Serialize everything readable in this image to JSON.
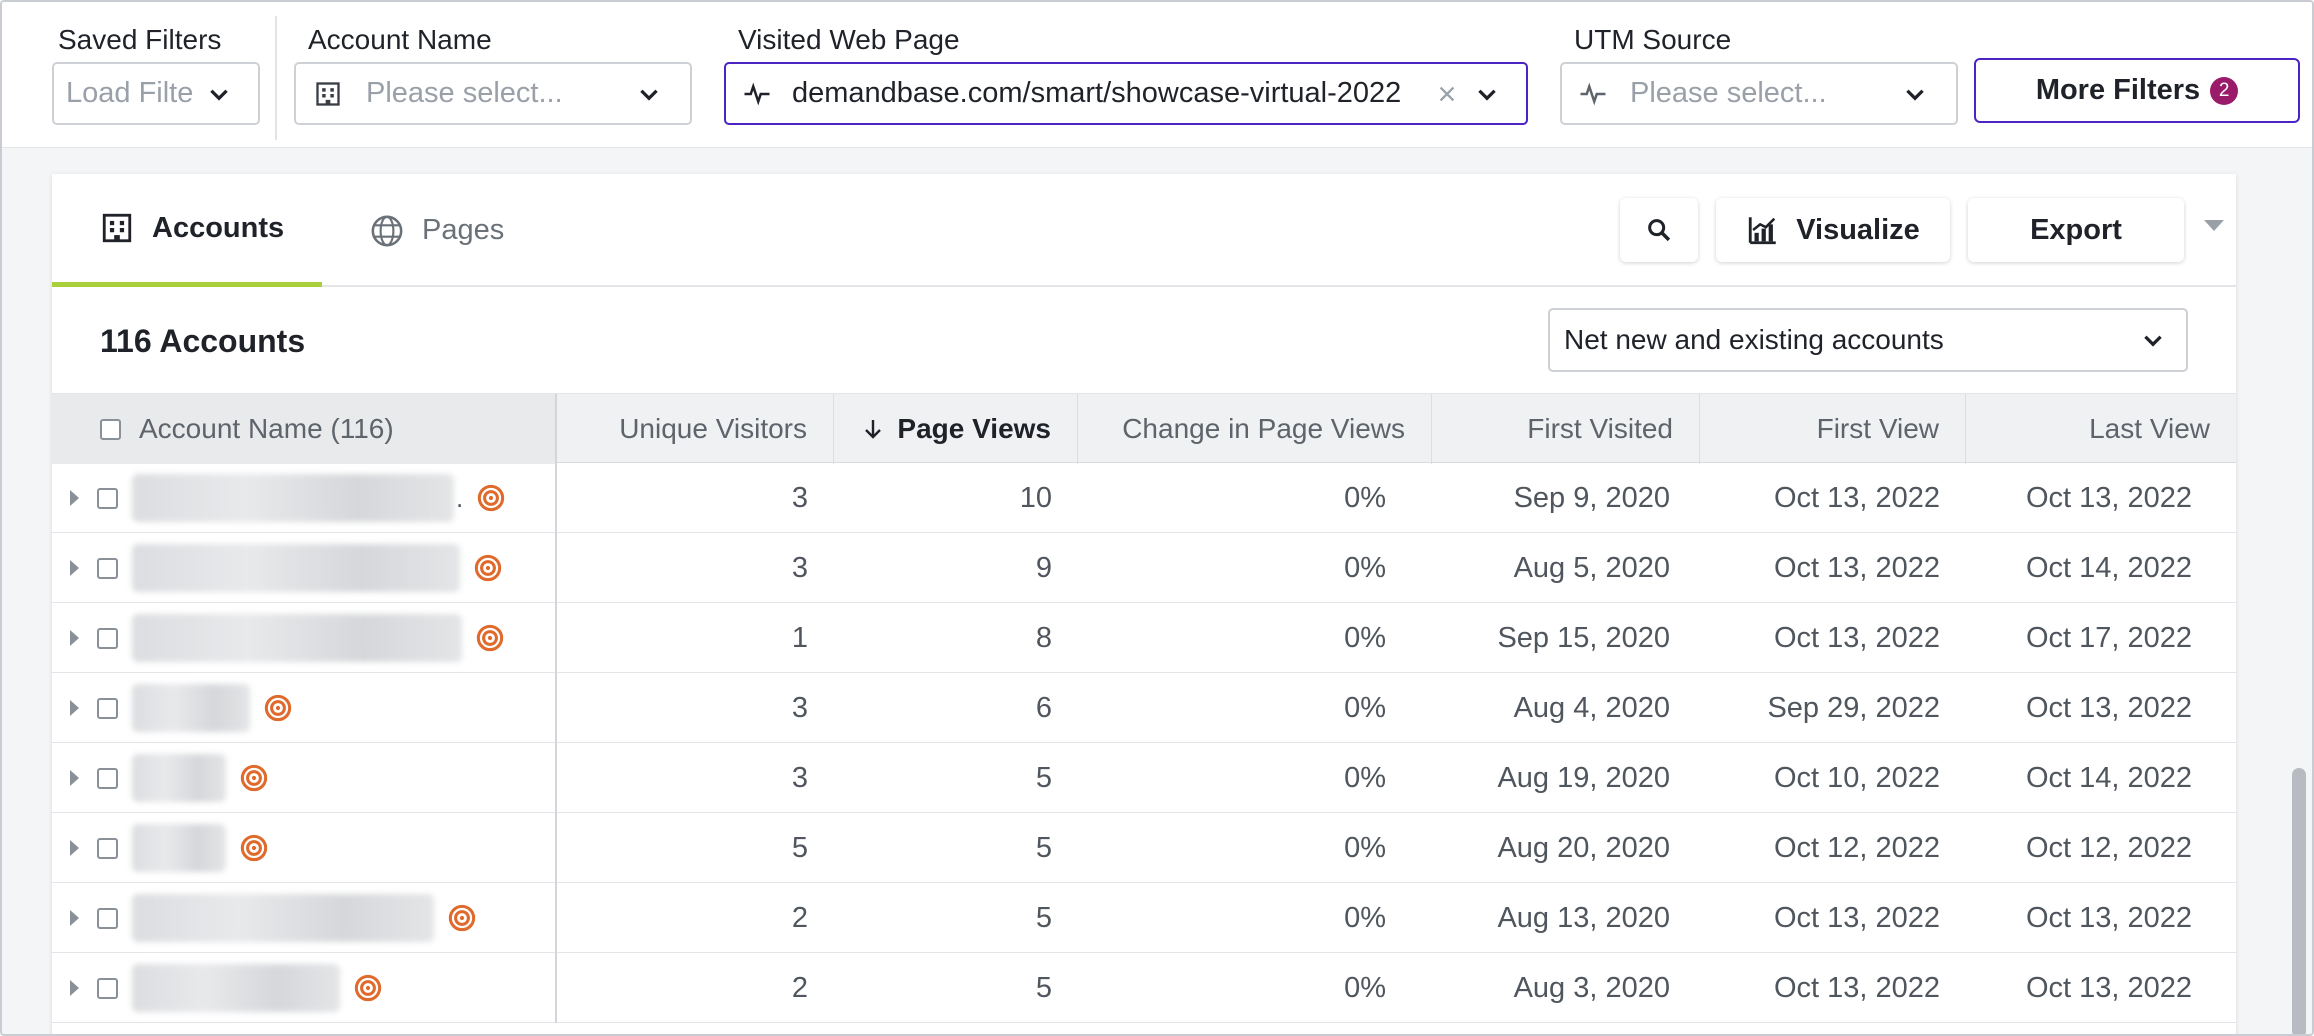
{
  "filters": {
    "saved": {
      "label": "Saved Filters",
      "placeholder": "Load Filte"
    },
    "account_name": {
      "label": "Account Name",
      "placeholder": "Please select..."
    },
    "visited_web_page": {
      "label": "Visited Web Page",
      "value": "demandbase.com/smart/showcase-virtual-2022"
    },
    "utm_source": {
      "label": "UTM Source",
      "placeholder": "Please select..."
    },
    "more_filters": {
      "label": "More Filters",
      "count": "2"
    }
  },
  "tabs": {
    "accounts": "Accounts",
    "pages": "Pages"
  },
  "toolbar": {
    "visualize": "Visualize",
    "export": "Export"
  },
  "summary": {
    "count_label": "116 Accounts",
    "segment_select": "Net new and existing accounts"
  },
  "table": {
    "headers": {
      "account_name": "Account Name (116)",
      "unique_visitors": "Unique Visitors",
      "page_views": "Page Views",
      "change": "Change in Page Views",
      "first_visited": "First Visited",
      "first_view": "First View",
      "last_view": "Last View"
    },
    "rows": [
      {
        "uv": "3",
        "pv": "10",
        "chg": "0%",
        "fv": "Sep 9, 2020",
        "fview": "Oct 13, 2022",
        "lview": "Oct 13, 2022"
      },
      {
        "uv": "3",
        "pv": "9",
        "chg": "0%",
        "fv": "Aug 5, 2020",
        "fview": "Oct 13, 2022",
        "lview": "Oct 14, 2022"
      },
      {
        "uv": "1",
        "pv": "8",
        "chg": "0%",
        "fv": "Sep 15, 2020",
        "fview": "Oct 13, 2022",
        "lview": "Oct 17, 2022"
      },
      {
        "uv": "3",
        "pv": "6",
        "chg": "0%",
        "fv": "Aug 4, 2020",
        "fview": "Sep 29, 2022",
        "lview": "Oct 13, 2022"
      },
      {
        "uv": "3",
        "pv": "5",
        "chg": "0%",
        "fv": "Aug 19, 2020",
        "fview": "Oct 10, 2022",
        "lview": "Oct 14, 2022"
      },
      {
        "uv": "5",
        "pv": "5",
        "chg": "0%",
        "fv": "Aug 20, 2020",
        "fview": "Oct 12, 2022",
        "lview": "Oct 12, 2022"
      },
      {
        "uv": "2",
        "pv": "5",
        "chg": "0%",
        "fv": "Aug 13, 2020",
        "fview": "Oct 13, 2022",
        "lview": "Oct 13, 2022"
      },
      {
        "uv": "2",
        "pv": "5",
        "chg": "0%",
        "fv": "Aug 3, 2020",
        "fview": "Oct 13, 2022",
        "lview": "Oct 13, 2022"
      }
    ]
  },
  "icons": {
    "building": "building-icon",
    "activity": "activity-icon",
    "globe": "globe-www-icon",
    "search": "search-icon",
    "chart": "chart-icon",
    "target": "target-icon"
  },
  "colors": {
    "accent": "#4b24c3",
    "tab_underline": "#a9cf3a",
    "badge": "#9b1b6b",
    "target": "#e06a2c"
  }
}
